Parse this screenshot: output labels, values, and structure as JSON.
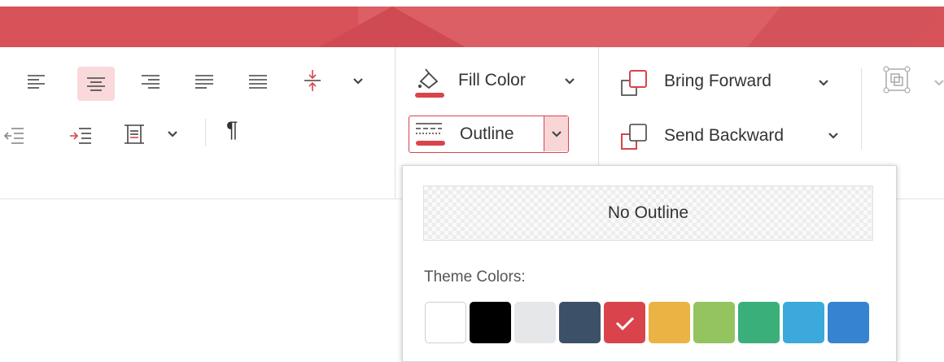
{
  "ribbon": {
    "fill_color_label": "Fill Color",
    "outline_label": "Outline",
    "bring_forward_label": "Bring Forward",
    "send_backward_label": "Send Backward",
    "paragraph_mark_glyph": "¶"
  },
  "outline_dropdown": {
    "no_outline_label": "No Outline",
    "theme_colors_label": "Theme Colors:",
    "swatches": [
      {
        "color": "#ffffff",
        "selected": false
      },
      {
        "color": "#000000",
        "selected": false
      },
      {
        "color": "#e6e7e9",
        "selected": false
      },
      {
        "color": "#3c5068",
        "selected": false
      },
      {
        "color": "#d9444c",
        "selected": true
      },
      {
        "color": "#ebb344",
        "selected": false
      },
      {
        "color": "#93c45f",
        "selected": false
      },
      {
        "color": "#3aaf7a",
        "selected": false
      },
      {
        "color": "#3ba9db",
        "selected": false
      },
      {
        "color": "#3583d1",
        "selected": false
      }
    ]
  },
  "colors": {
    "accent": "#d9444c",
    "banner": "#d85259",
    "active_bg": "#f9d9da"
  }
}
